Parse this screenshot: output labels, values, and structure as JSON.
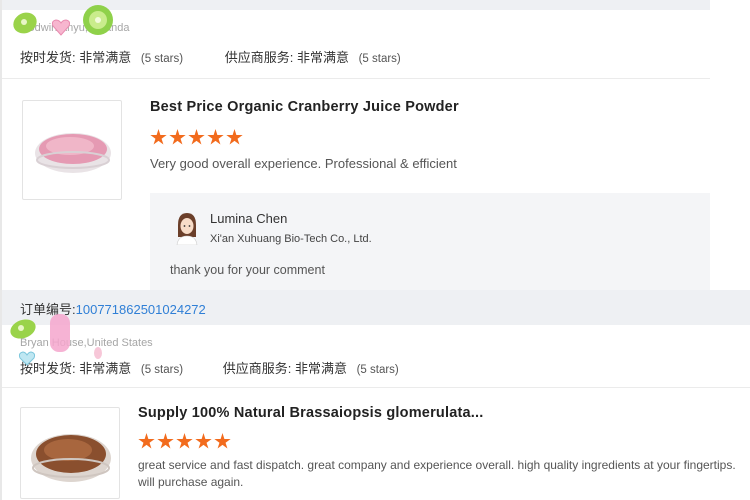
{
  "reviews": [
    {
      "reviewer_meta": "Godwin Anyu, Uganda",
      "delivery_label": "按时发货:",
      "delivery_value": "非常满意",
      "delivery_stars": "(5 stars)",
      "supplier_label": "供应商服务:",
      "supplier_value": "非常满意",
      "supplier_stars": "(5 stars)",
      "product_title": "Best Price Organic Cranberry Juice Powder",
      "rating": 5,
      "comment": "Very good overall experience. Professional & efficient",
      "reply": {
        "name": "Lumina Chen",
        "company": "Xi'an Xuhuang Bio-Tech Co., Ltd.",
        "text": "thank you for your comment"
      }
    },
    {
      "order_label": "订单编号:",
      "order_number": "100771862501024272",
      "reviewer_meta": "Bryan House,United States",
      "delivery_label": "按时发货:",
      "delivery_value": "非常满意",
      "delivery_stars": "(5 stars)",
      "supplier_label": "供应商服务:",
      "supplier_value": "非常满意",
      "supplier_stars": "(5 stars)",
      "product_title": "Supply 100% Natural Brassaiopsis glomerulata...",
      "rating": 5,
      "comment": "great service and fast dispatch. great company and experience overall. high quality ingredients at your fingertips. will purchase again."
    }
  ],
  "colors": {
    "star": "#f26b1d",
    "order_number": "#2f7fd6",
    "reply_bg": "#f4f5f7"
  },
  "icons": {
    "stickers": [
      "kiwi-sticker-icon",
      "heart-sticker-icon"
    ],
    "avatar": "avatar-icon"
  }
}
